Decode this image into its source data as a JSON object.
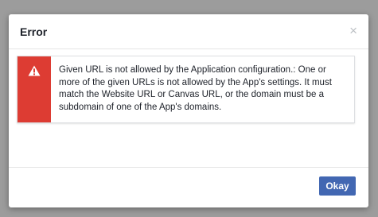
{
  "dialog": {
    "title": "Error",
    "close_symbol": "×",
    "error_message": "Given URL is not allowed by the Application configuration.: One or more of the given URLs is not allowed by the App's settings. It must match the Website URL or Canvas URL, or the domain must be a subdomain of one of the App's domains.",
    "ok_label": "Okay"
  },
  "icons": {
    "warning": "warning-triangle-icon",
    "close": "close-icon"
  },
  "colors": {
    "backdrop": "#9c9c9c",
    "error_accent": "#dd3c33",
    "primary_button": "#4267b2"
  }
}
